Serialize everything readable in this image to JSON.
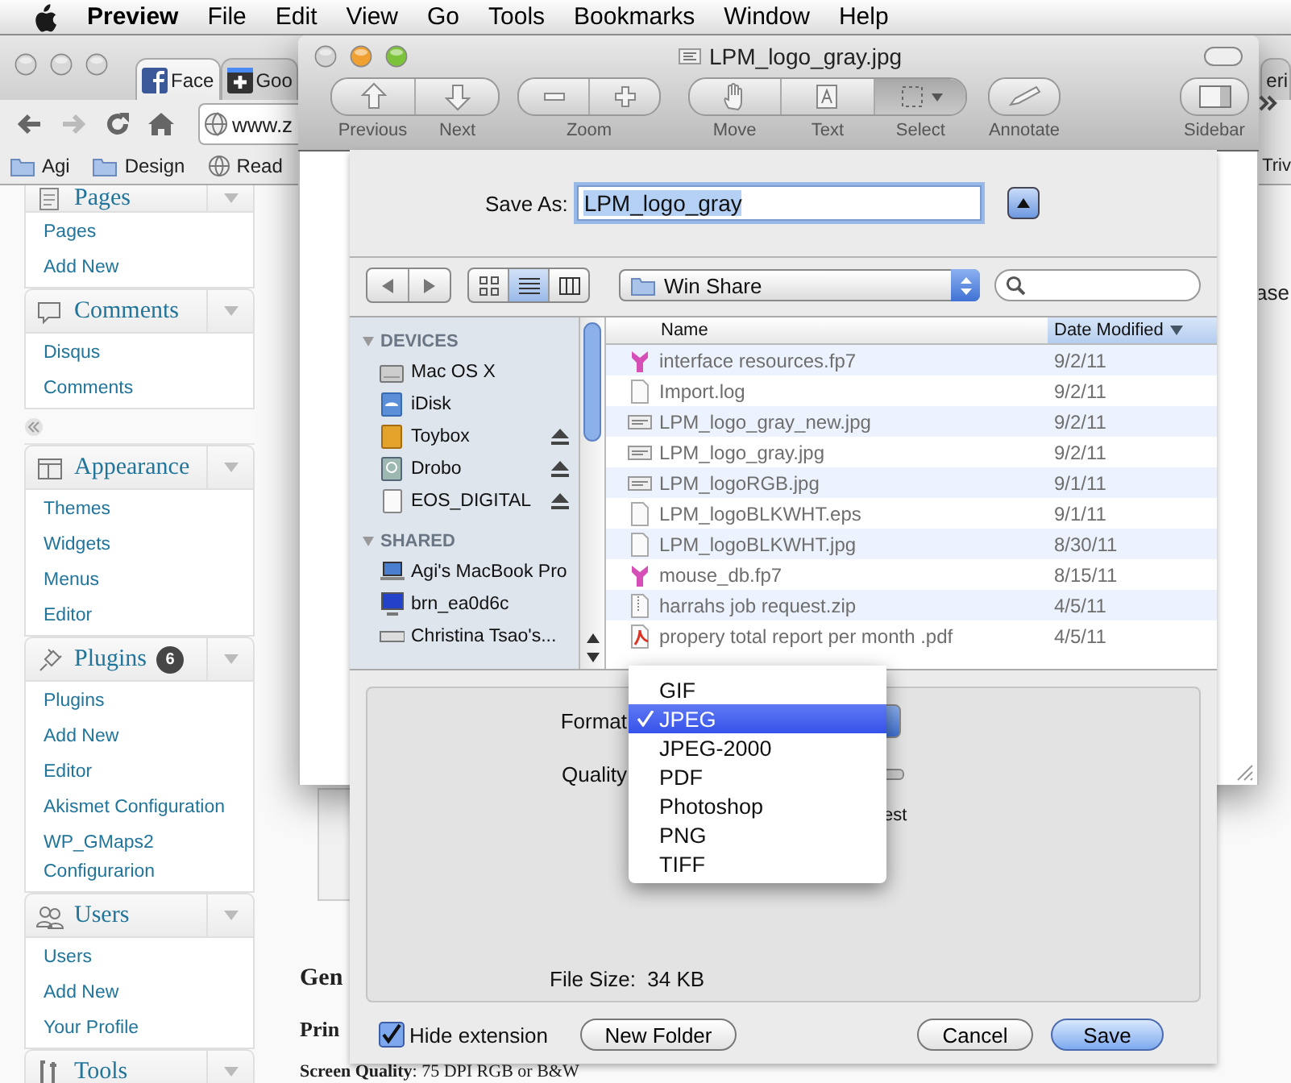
{
  "menubar": {
    "app": "Preview",
    "items": [
      "File",
      "Edit",
      "View",
      "Go",
      "Tools",
      "Bookmarks",
      "Window",
      "Help"
    ]
  },
  "browser": {
    "tabs": [
      {
        "label": "Face",
        "kind": "facebook",
        "selected": true
      },
      {
        "label": "Goo",
        "kind": "plus",
        "selected": false
      }
    ],
    "edge_tab": "eri",
    "url": "www.z",
    "bookmarks": [
      {
        "label": "Agi",
        "kind": "folder"
      },
      {
        "label": "Design",
        "kind": "folder"
      },
      {
        "label": "Read",
        "kind": "globe"
      }
    ],
    "edge_bookmark": "Triv",
    "admin_menu": [
      {
        "title": "Pages",
        "kind": "pages",
        "collapse_handle": false,
        "items": [
          "Pages",
          "Add New"
        ]
      },
      {
        "title": "Comments",
        "kind": "comments",
        "collapse_handle": true,
        "items": [
          "Disqus",
          "Comments"
        ]
      },
      {
        "title": "Appearance",
        "kind": "appearance",
        "collapse_handle": false,
        "items": [
          "Themes",
          "Widgets",
          "Menus",
          "Editor"
        ]
      },
      {
        "title": "Plugins",
        "kind": "plugins",
        "badge": "6",
        "collapse_handle": false,
        "items": [
          "Plugins",
          "Add New",
          "Editor",
          "Akismet Configuration",
          "WP_GMaps2 Configurarion"
        ]
      },
      {
        "title": "Users",
        "kind": "users",
        "collapse_handle": false,
        "items": [
          "Users",
          "Add New",
          "Your Profile"
        ]
      },
      {
        "title": "Tools",
        "kind": "tools",
        "collapse_handle": false
      }
    ],
    "page": {
      "side_text": "ase",
      "heading": "Gen",
      "line_1": "Prin",
      "line_2": "**Screen Quality**: 75 DPI RGB or B&W"
    }
  },
  "preview": {
    "title": "LPM_logo_gray.jpg",
    "toolbar": [
      {
        "kind": "pager",
        "labels": [
          "Previous",
          "Next"
        ]
      },
      {
        "kind": "zoom",
        "labels": [
          "Zoom"
        ]
      },
      {
        "kind": "tools",
        "items": [
          {
            "label": "Move",
            "selected": false
          },
          {
            "label": "Text",
            "selected": false
          },
          {
            "label": "Select",
            "selected": true
          }
        ]
      },
      {
        "kind": "annotate",
        "labels": [
          "Annotate"
        ]
      },
      {
        "kind": "sidebar",
        "labels": [
          "Sidebar"
        ]
      }
    ]
  },
  "save_sheet": {
    "save_as_label": "Save As:",
    "file_name": "LPM_logo_gray",
    "view_modes": [
      {
        "kind": "icon",
        "selected": false
      },
      {
        "kind": "list",
        "selected": true
      },
      {
        "kind": "column",
        "selected": false
      }
    ],
    "location": "Win Share",
    "sidebar": [
      {
        "title": "DEVICES",
        "expanded": true,
        "items": [
          {
            "label": "Mac OS X",
            "kind": "harddisk",
            "eject": false
          },
          {
            "label": "iDisk",
            "kind": "idisk",
            "eject": false
          },
          {
            "label": "Toybox",
            "kind": "drive",
            "eject": true
          },
          {
            "label": "Drobo",
            "kind": "drobo",
            "eject": true
          },
          {
            "label": "EOS_DIGITAL",
            "kind": "card",
            "eject": true
          }
        ]
      },
      {
        "title": "SHARED",
        "expanded": true,
        "items": [
          {
            "label": "Agi's MacBook Pro",
            "kind": "laptop",
            "eject": false
          },
          {
            "label": "brn_ea0d6c",
            "kind": "monitor",
            "eject": false
          },
          {
            "label": "Christina Tsao's...",
            "kind": "server",
            "eject": false
          }
        ]
      }
    ],
    "columns": [
      {
        "label": "Name",
        "selected": false
      },
      {
        "label": "Date Modified",
        "selected": true
      }
    ],
    "files": [
      {
        "name": "interface resources.fp7",
        "date": "9/2/11",
        "kind": "database"
      },
      {
        "name": "Import.log",
        "date": "9/2/11",
        "kind": "log"
      },
      {
        "name": "LPM_logo_gray_new.jpg",
        "date": "9/2/11",
        "kind": "image"
      },
      {
        "name": "LPM_logo_gray.jpg",
        "date": "9/2/11",
        "kind": "image"
      },
      {
        "name": "LPM_logoRGB.jpg",
        "date": "9/1/11",
        "kind": "image"
      },
      {
        "name": "LPM_logoBLKWHT.eps",
        "date": "9/1/11",
        "kind": "log"
      },
      {
        "name": "LPM_logoBLKWHT.jpg",
        "date": "8/30/11",
        "kind": "log"
      },
      {
        "name": "mouse_db.fp7",
        "date": "8/15/11",
        "kind": "database"
      },
      {
        "name": "harrahs job request.zip",
        "date": "4/5/11",
        "kind": "zip"
      },
      {
        "name": "propery total report per month .pdf",
        "date": "4/5/11",
        "kind": "pdf"
      }
    ],
    "format_label": "Format",
    "quality_label": "Quality",
    "quality_end": "est",
    "file_size": "File Size:  34 KB",
    "hide_extension": {
      "label": "Hide extension",
      "checked": true
    },
    "buttons": [
      {
        "label": "New Folder",
        "kind": "normal"
      },
      {
        "label": "Cancel",
        "kind": "normal"
      },
      {
        "label": "Save",
        "kind": "default"
      }
    ]
  },
  "format_menu": [
    {
      "label": "GIF",
      "selected": false
    },
    {
      "label": "JPEG",
      "selected": true
    },
    {
      "label": "JPEG-2000",
      "selected": false
    },
    {
      "label": "PDF",
      "selected": false
    },
    {
      "label": "Photoshop",
      "selected": false
    },
    {
      "label": "PNG",
      "selected": false
    },
    {
      "label": "TIFF",
      "selected": false
    }
  ]
}
